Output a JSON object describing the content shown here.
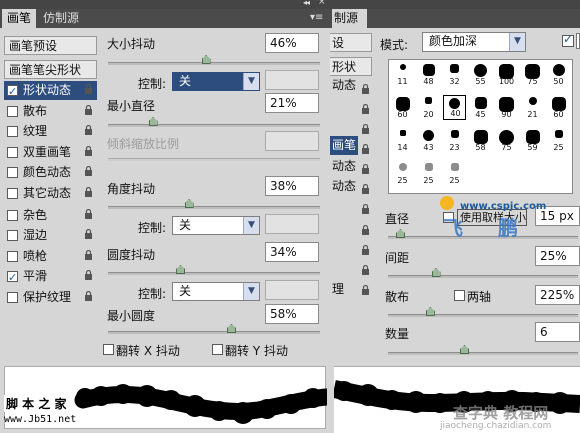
{
  "top_bar": {
    "collapse_glyph": "◂◂",
    "close_glyph": "×"
  },
  "tabs": {
    "brush": "画笔",
    "clone_source": "仿制源"
  },
  "tab_menu": "▾≡",
  "brush_list": [
    {
      "label": "画笔预设",
      "kind": "header"
    },
    {
      "label": "画笔笔尖形状",
      "kind": "header"
    },
    {
      "label": "形状动态",
      "kind": "item",
      "checked": true,
      "selected": true,
      "lock": true
    },
    {
      "label": "散布",
      "kind": "item",
      "checked": false,
      "lock": true
    },
    {
      "label": "纹理",
      "kind": "item",
      "checked": false,
      "lock": true
    },
    {
      "label": "双重画笔",
      "kind": "item",
      "checked": false,
      "lock": true
    },
    {
      "label": "颜色动态",
      "kind": "item",
      "checked": false,
      "lock": true
    },
    {
      "label": "其它动态",
      "kind": "item",
      "checked": false,
      "lock": true
    },
    {
      "label": "杂色",
      "kind": "item",
      "checked": false,
      "lock": true
    },
    {
      "label": "湿边",
      "kind": "item",
      "checked": false,
      "lock": true
    },
    {
      "label": "喷枪",
      "kind": "item",
      "checked": false,
      "lock": true
    },
    {
      "label": "平滑",
      "kind": "item",
      "checked": true,
      "lock": true
    },
    {
      "label": "保护纹理",
      "kind": "item",
      "checked": false,
      "lock": true
    }
  ],
  "shape_dynamics": {
    "size_jitter": {
      "label": "大小抖动",
      "value": "46%",
      "level": 0.46
    },
    "size_control": {
      "label": "控制:",
      "value": "关"
    },
    "min_diameter": {
      "label": "最小直径",
      "value": "21%",
      "level": 0.21
    },
    "tilt_scale": {
      "label": "倾斜缩放比例",
      "value": ""
    },
    "angle_jitter": {
      "label": "角度抖动",
      "value": "38%",
      "level": 0.38
    },
    "angle_control": {
      "label": "控制:",
      "value": "关"
    },
    "roundness_jitter": {
      "label": "圆度抖动",
      "value": "34%",
      "level": 0.34
    },
    "roundness_control": {
      "label": "控制:",
      "value": "关"
    },
    "min_roundness": {
      "label": "最小圆度",
      "value": "58%",
      "level": 0.58
    },
    "flip_x": {
      "label": "翻转 X 抖动",
      "checked": false
    },
    "flip_y": {
      "label": "翻转 Y 抖动",
      "checked": false
    }
  },
  "right_panel": {
    "tab": "制源",
    "mode_label": "模式:",
    "mode_value": "颜色加深",
    "enable_checked": true,
    "enable_label": "",
    "list_fragments": [
      "设",
      "形状",
      "动态",
      "画笔",
      "动态",
      "动态",
      "理"
    ],
    "brush_presets": [
      "11",
      "48",
      "32",
      "55",
      "100",
      "75",
      "50",
      "60",
      "20",
      "40",
      "45",
      "90",
      "21",
      "60",
      "14",
      "43",
      "23",
      "58",
      "75",
      "59",
      "25",
      "25",
      "25",
      "25"
    ],
    "diameter_label": "直径",
    "use_sample_label": "使用取样大小",
    "diameter_value": "15 px",
    "spacing_label": "间距",
    "spacing_value": "25%",
    "spacing_level": 0.25,
    "scatter_label": "散布",
    "both_axes_label": "两轴",
    "both_axes_checked": false,
    "scatter_value": "225%",
    "scatter_level": 0.22,
    "count_label": "数量",
    "count_value": "6",
    "count_level": 0.4
  },
  "watermarks": {
    "left_site": "脚 本 之 家",
    "left_url": "www.Jb51.net",
    "right_url": "www.cspjc.com",
    "right_logo": "飞 鹏",
    "bottom_site": "查字典 教程网",
    "bottom_url": "jiaocheng.chazidian.com"
  }
}
